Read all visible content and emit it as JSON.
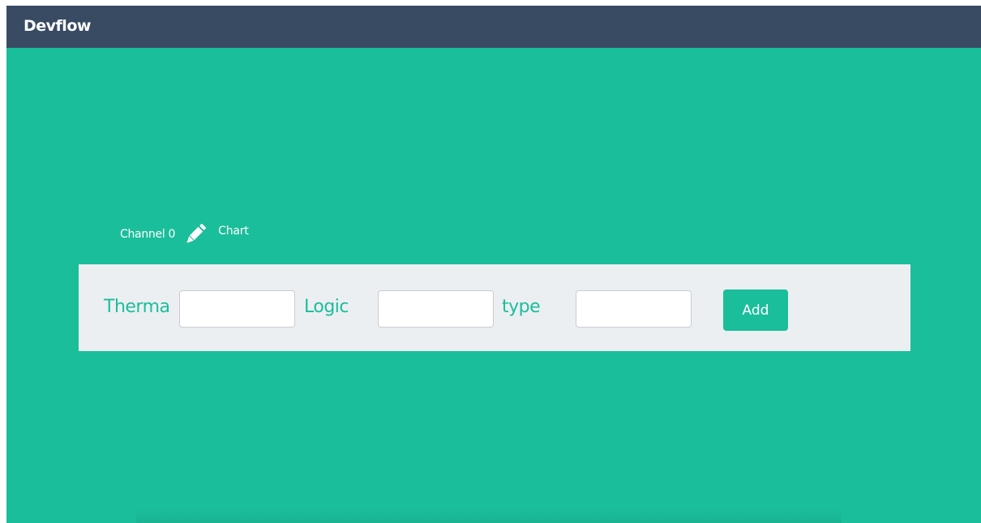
{
  "navbar": {
    "brand": "Devflow"
  },
  "channel": {
    "label": "Channel 0",
    "edit_icon": "pencil-icon",
    "chart_link": "Chart"
  },
  "form": {
    "fields": [
      {
        "label": "Therma",
        "value": "",
        "placeholder": ""
      },
      {
        "label": "Logic",
        "value": "",
        "placeholder": ""
      },
      {
        "label": "type",
        "value": "",
        "placeholder": ""
      }
    ],
    "add_label": "Add"
  },
  "colors": {
    "navbar": "#394a63",
    "accent": "#1bbe9b",
    "form_background": "#eceff2"
  }
}
